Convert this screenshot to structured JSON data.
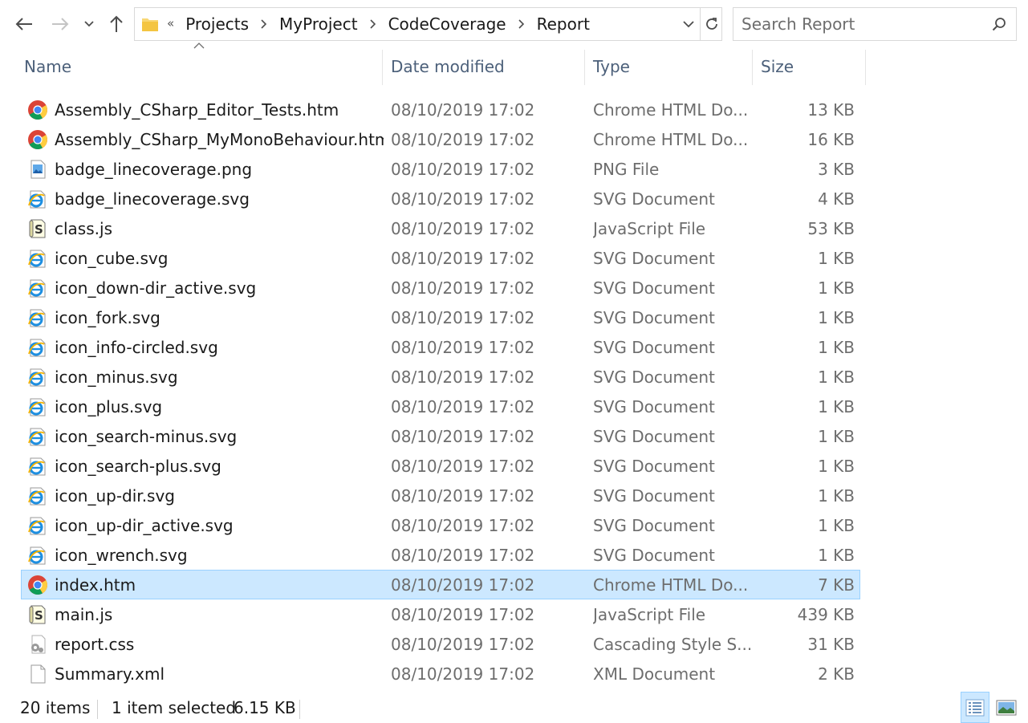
{
  "nav": {
    "back_icon": "arrow-left-icon",
    "forward_icon": "arrow-right-icon",
    "recent_icon": "chevron-down-icon",
    "up_icon": "arrow-up-icon"
  },
  "address": {
    "overflow": "«",
    "crumbs": [
      "Projects",
      "MyProject",
      "CodeCoverage",
      "Report"
    ]
  },
  "search": {
    "placeholder": "Search Report"
  },
  "columns": {
    "name": "Name",
    "date": "Date modified",
    "type": "Type",
    "size": "Size"
  },
  "files": [
    {
      "name": "Assembly_CSharp_Editor_Tests.htm",
      "date": "08/10/2019 17:02",
      "type": "Chrome HTML Do...",
      "size": "13 KB",
      "icon": "chrome"
    },
    {
      "name": "Assembly_CSharp_MyMonoBehaviour.htm",
      "date": "08/10/2019 17:02",
      "type": "Chrome HTML Do...",
      "size": "16 KB",
      "icon": "chrome"
    },
    {
      "name": "badge_linecoverage.png",
      "date": "08/10/2019 17:02",
      "type": "PNG File",
      "size": "3 KB",
      "icon": "image"
    },
    {
      "name": "badge_linecoverage.svg",
      "date": "08/10/2019 17:02",
      "type": "SVG Document",
      "size": "4 KB",
      "icon": "ie"
    },
    {
      "name": "class.js",
      "date": "08/10/2019 17:02",
      "type": "JavaScript File",
      "size": "53 KB",
      "icon": "script"
    },
    {
      "name": "icon_cube.svg",
      "date": "08/10/2019 17:02",
      "type": "SVG Document",
      "size": "1 KB",
      "icon": "ie"
    },
    {
      "name": "icon_down-dir_active.svg",
      "date": "08/10/2019 17:02",
      "type": "SVG Document",
      "size": "1 KB",
      "icon": "ie"
    },
    {
      "name": "icon_fork.svg",
      "date": "08/10/2019 17:02",
      "type": "SVG Document",
      "size": "1 KB",
      "icon": "ie"
    },
    {
      "name": "icon_info-circled.svg",
      "date": "08/10/2019 17:02",
      "type": "SVG Document",
      "size": "1 KB",
      "icon": "ie"
    },
    {
      "name": "icon_minus.svg",
      "date": "08/10/2019 17:02",
      "type": "SVG Document",
      "size": "1 KB",
      "icon": "ie"
    },
    {
      "name": "icon_plus.svg",
      "date": "08/10/2019 17:02",
      "type": "SVG Document",
      "size": "1 KB",
      "icon": "ie"
    },
    {
      "name": "icon_search-minus.svg",
      "date": "08/10/2019 17:02",
      "type": "SVG Document",
      "size": "1 KB",
      "icon": "ie"
    },
    {
      "name": "icon_search-plus.svg",
      "date": "08/10/2019 17:02",
      "type": "SVG Document",
      "size": "1 KB",
      "icon": "ie"
    },
    {
      "name": "icon_up-dir.svg",
      "date": "08/10/2019 17:02",
      "type": "SVG Document",
      "size": "1 KB",
      "icon": "ie"
    },
    {
      "name": "icon_up-dir_active.svg",
      "date": "08/10/2019 17:02",
      "type": "SVG Document",
      "size": "1 KB",
      "icon": "ie"
    },
    {
      "name": "icon_wrench.svg",
      "date": "08/10/2019 17:02",
      "type": "SVG Document",
      "size": "1 KB",
      "icon": "ie"
    },
    {
      "name": "index.htm",
      "date": "08/10/2019 17:02",
      "type": "Chrome HTML Do...",
      "size": "7 KB",
      "icon": "chrome",
      "selected": true
    },
    {
      "name": "main.js",
      "date": "08/10/2019 17:02",
      "type": "JavaScript File",
      "size": "439 KB",
      "icon": "script"
    },
    {
      "name": "report.css",
      "date": "08/10/2019 17:02",
      "type": "Cascading Style S...",
      "size": "31 KB",
      "icon": "css"
    },
    {
      "name": "Summary.xml",
      "date": "08/10/2019 17:02",
      "type": "XML Document",
      "size": "2 KB",
      "icon": "xml"
    }
  ],
  "status": {
    "item_count": "20 items",
    "selection": "1 item selected",
    "selection_size": "6.15 KB"
  },
  "views": {
    "details_icon": "details-view-icon",
    "large_icons_icon": "large-icons-view-icon",
    "active": "details"
  },
  "colors": {
    "selected_bg": "#cce8ff",
    "selected_border": "#99d1ff",
    "header_text": "#4c607a",
    "secondary_text": "#6d6d6d"
  }
}
